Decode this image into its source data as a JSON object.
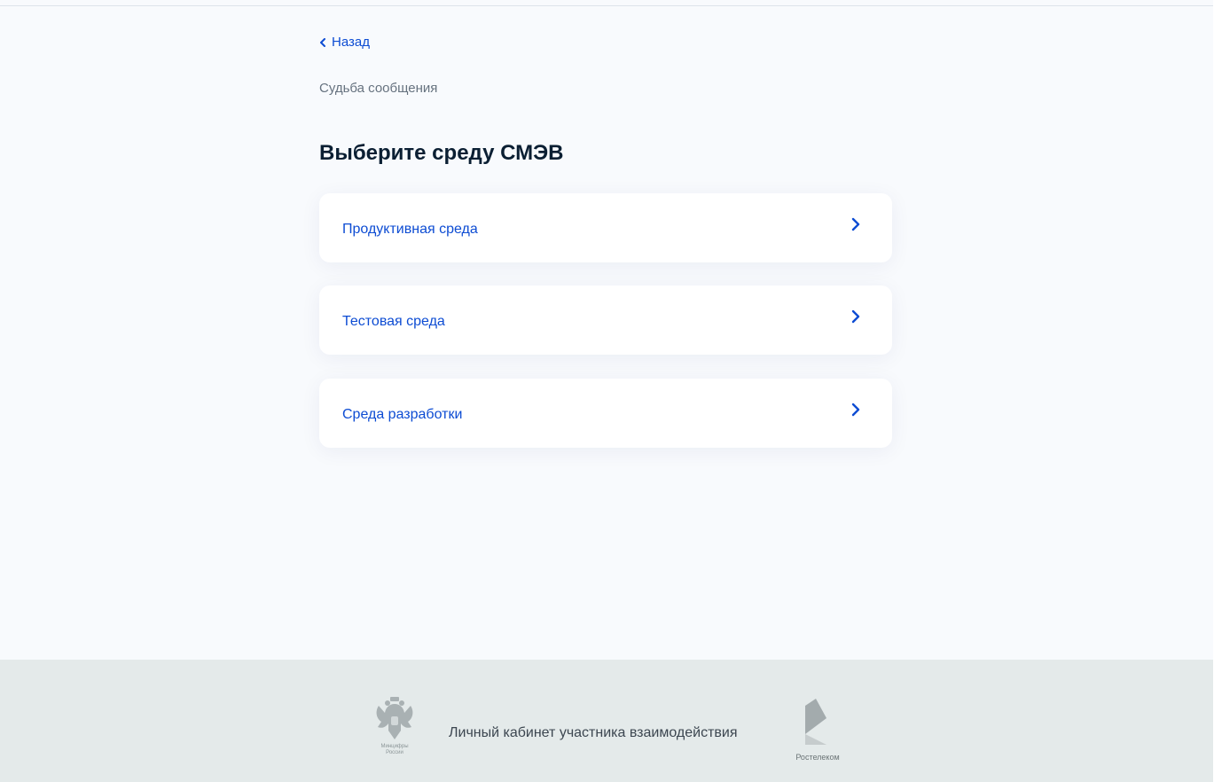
{
  "nav": {
    "back_label": "Назад"
  },
  "breadcrumb": "Судьба сообщения",
  "title": "Выберите среду СМЭВ",
  "environments": [
    {
      "label": "Продуктивная среда"
    },
    {
      "label": "Тестовая среда"
    },
    {
      "label": "Среда разработки"
    }
  ],
  "footer": {
    "ministry_line1": "Минцифры",
    "ministry_line2": "России",
    "portal_title": "Личный кабинет участника взаимодействия",
    "partner_name": "Ростелеком"
  },
  "colors": {
    "accent": "#0d4cd3",
    "page_background": "#f8fafd",
    "footer_background": "#e4eaea"
  },
  "icons": [
    "chevron-left-icon",
    "chevron-right-icon",
    "state-emblem-icon",
    "rostelecom-logo-icon"
  ]
}
